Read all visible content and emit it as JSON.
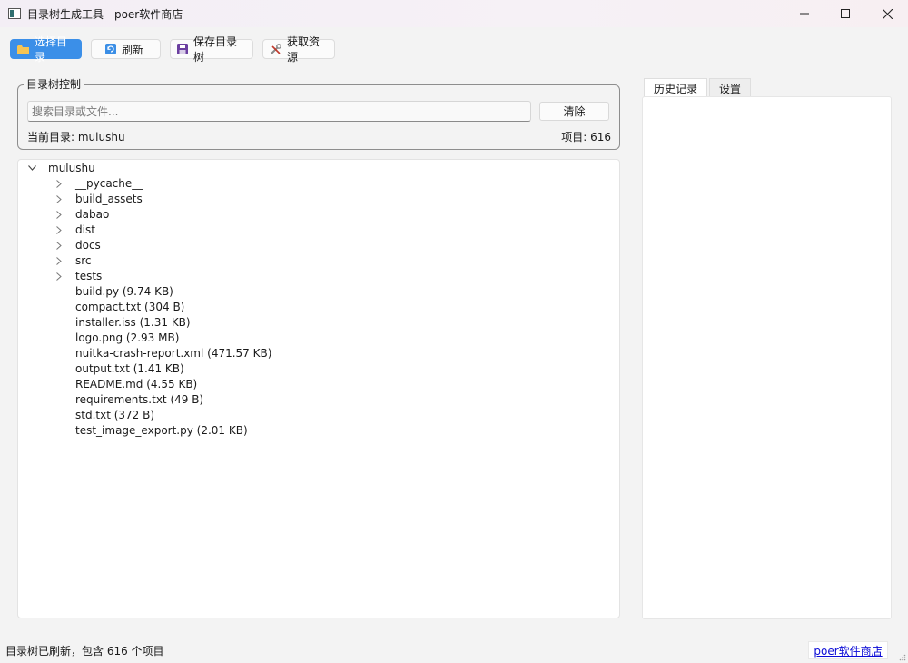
{
  "window": {
    "title": "目录树生成工具 - poer软件商店",
    "minimize_icon": "minimize-icon",
    "maximize_icon": "maximize-icon",
    "close_icon": "close-icon"
  },
  "toolbar": {
    "select_dir_label": "选择目录",
    "refresh_label": "刷新",
    "save_tree_label": "保存目录树",
    "get_resources_label": "获取资源",
    "accent_color": "#3b8fe8"
  },
  "control_group": {
    "title": "目录树控制",
    "search_placeholder": "搜索目录或文件...",
    "search_value": "",
    "clear_label": "清除",
    "current_dir_text": "当前目录: mulushu",
    "item_count_text": "项目: 616"
  },
  "tree": {
    "root": "mulushu",
    "folders": [
      "__pycache__",
      "build_assets",
      "dabao",
      "dist",
      "docs",
      "src",
      "tests"
    ],
    "files": [
      "build.py (9.74 KB)",
      "compact.txt (304 B)",
      "installer.iss (1.31 KB)",
      "logo.png (2.93 MB)",
      "nuitka-crash-report.xml (471.57 KB)",
      "output.txt (1.41 KB)",
      "README.md (4.55 KB)",
      "requirements.txt (49 B)",
      "std.txt (372 B)",
      "test_image_export.py (2.01 KB)"
    ]
  },
  "side_tabs": [
    "历史记录",
    "设置"
  ],
  "status": {
    "message": "目录树已刷新，包含 616 个项目",
    "store_link": "poer软件商店"
  }
}
